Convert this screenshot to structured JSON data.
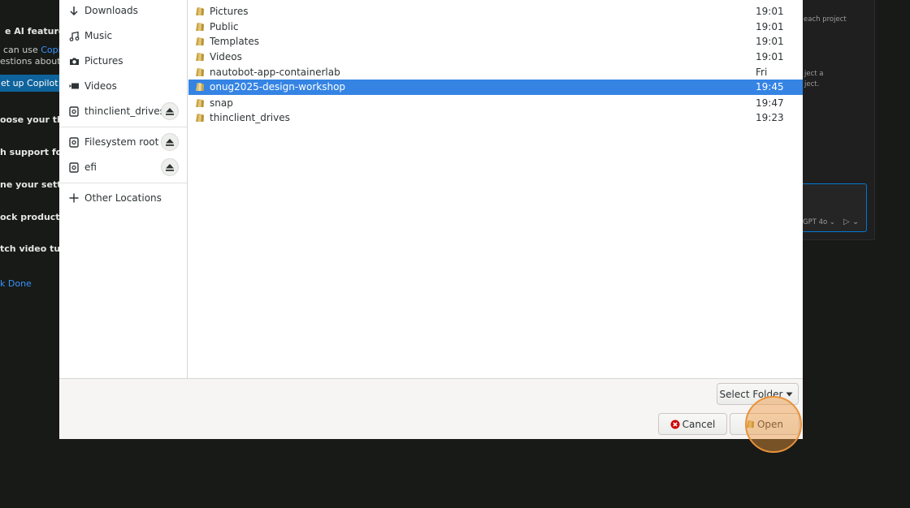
{
  "background": {
    "left_fragments": {
      "ai_features": "e AI features",
      "can_use": "can use",
      "copilot_link": "Copi",
      "questions_about": "estions about",
      "setup_copilot": "et up Copilot",
      "choose_theme": "oose your th",
      "rich_support": "h support fo",
      "tune_settings": "ne your setti",
      "unlock_productivity": "ock product",
      "watch_video": "tch video tu",
      "mark_done": "k Done"
    },
    "right_fragments": {
      "each_project": "each project",
      "project_a": "ject a",
      "ject": "ject.",
      "model": "GPT 4o"
    }
  },
  "dialog": {
    "sidebar": {
      "items": [
        {
          "label": "Downloads",
          "icon": "download-icon"
        },
        {
          "label": "Music",
          "icon": "music-icon"
        },
        {
          "label": "Pictures",
          "icon": "camera-icon"
        },
        {
          "label": "Videos",
          "icon": "video-icon"
        },
        {
          "label": "thinclient_drives",
          "icon": "drive-icon",
          "eject": true
        },
        {
          "label": "Filesystem root",
          "icon": "drive-icon",
          "eject": true
        },
        {
          "label": "efi",
          "icon": "drive-icon",
          "eject": true
        },
        {
          "label": "Other Locations",
          "icon": "plus-icon"
        }
      ]
    },
    "files": [
      {
        "name": "Pictures",
        "time": "19:01"
      },
      {
        "name": "Public",
        "time": "19:01"
      },
      {
        "name": "Templates",
        "time": "19:01"
      },
      {
        "name": "Videos",
        "time": "19:01"
      },
      {
        "name": "nautobot-app-containerlab",
        "time": "Fri"
      },
      {
        "name": "onug2025-design-workshop",
        "time": "19:45",
        "selected": true
      },
      {
        "name": "snap",
        "time": "19:47"
      },
      {
        "name": "thinclient_drives",
        "time": "19:23"
      }
    ],
    "footer": {
      "filter_label": "Select Folder",
      "cancel_label": "Cancel",
      "open_label": "Open"
    }
  }
}
